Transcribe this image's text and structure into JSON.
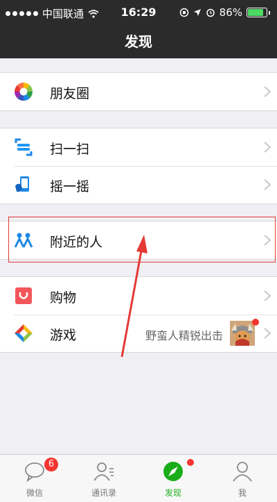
{
  "status_bar": {
    "carrier": "中国联通",
    "time": "16:29",
    "battery": "86%"
  },
  "header": {
    "title": "发现"
  },
  "items": [
    {
      "label": "朋友圈",
      "icon": "moments-icon"
    },
    {
      "label": "扫一扫",
      "icon": "scan-icon"
    },
    {
      "label": "摇一摇",
      "icon": "shake-icon"
    },
    {
      "label": "附近的人",
      "icon": "people-nearby-icon"
    },
    {
      "label": "购物",
      "icon": "shopping-icon"
    },
    {
      "label": "游戏",
      "icon": "games-icon",
      "sub": "野蛮人精锐出击"
    }
  ],
  "tabs": [
    {
      "label": "微信",
      "badge": "6"
    },
    {
      "label": "通讯录"
    },
    {
      "label": "发现"
    },
    {
      "label": "我"
    }
  ],
  "colors": {
    "accent": "#1aad19",
    "badge": "#f43530",
    "highlight": "#e53935"
  }
}
